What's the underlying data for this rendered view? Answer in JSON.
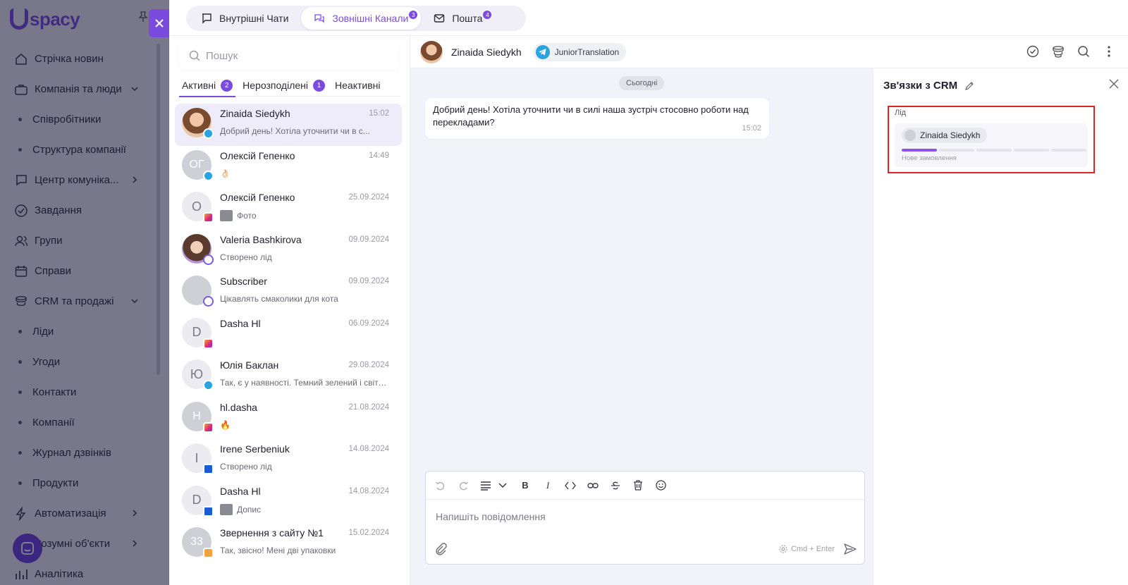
{
  "app": {
    "logo": "spacy",
    "nav": [
      {
        "label": "Стрічка новин",
        "icon": "home-icon"
      },
      {
        "label": "Компанія та люди",
        "icon": "briefcase-icon",
        "expandable": true
      },
      {
        "label": "Співробітники",
        "sub": true
      },
      {
        "label": "Структура компанії",
        "sub": true
      },
      {
        "label": "Центр комуніка...",
        "icon": "chat-icon",
        "expandable": true
      },
      {
        "label": "Завдання",
        "icon": "check-circle-icon"
      },
      {
        "label": "Групи",
        "icon": "users-icon"
      },
      {
        "label": "Справи",
        "icon": "calendar-icon"
      },
      {
        "label": "CRM та продажі",
        "icon": "funnel-icon",
        "expandable": true
      },
      {
        "label": "Ліди",
        "sub": true
      },
      {
        "label": "Угоди",
        "sub": true
      },
      {
        "label": "Контакти",
        "sub": true
      },
      {
        "label": "Компанії",
        "sub": true
      },
      {
        "label": "Журнал дзвінків",
        "sub": true
      },
      {
        "label": "Продукти",
        "sub": true
      },
      {
        "label": "Автоматизація",
        "icon": "bolt-icon",
        "expandable": true
      },
      {
        "label": "Розумні об'єкти",
        "icon": "cube-icon",
        "expandable": true
      },
      {
        "label": "Аналітика",
        "icon": "chart-icon"
      }
    ]
  },
  "tabs": [
    {
      "label": "Внутрішні Чати",
      "icon": "chat-bubble-icon",
      "badge": ""
    },
    {
      "label": "Зовнішні Канали",
      "icon": "channels-icon",
      "badge": "3",
      "active": true
    },
    {
      "label": "Пошта",
      "icon": "mail-icon",
      "badge": "4"
    }
  ],
  "chat_list": {
    "search_placeholder": "Пошук",
    "subtabs": [
      {
        "label": "Активні",
        "count": "2",
        "active": true
      },
      {
        "label": "Нерозподілені",
        "count": "1"
      },
      {
        "label": "Неактивні",
        "count": ""
      }
    ],
    "items": [
      {
        "name": "Zinaida Siedykh",
        "time": "15:02",
        "message": "Добрий день! Хотіла уточнити чи в с...",
        "initials": "",
        "avatar": "photo1",
        "channel": "telegram",
        "selected": true
      },
      {
        "name": "Олексій Гепенко",
        "time": "14:49",
        "message": "👌🏻",
        "initials": "ОГ",
        "avatar": "gray",
        "channel": "telegram"
      },
      {
        "name": "Олексій Гепенко",
        "time": "25.09.2024",
        "message": "Фото",
        "initials": "О",
        "avatar": "light",
        "channel": "instagram",
        "thumb": true
      },
      {
        "name": "Valeria Bashkirova",
        "time": "09.09.2024",
        "message": "Створено лід",
        "initials": "",
        "avatar": "photo2",
        "channel": "viber"
      },
      {
        "name": "Subscriber",
        "time": "09.09.2024",
        "message": "Цікавлять смаколики для кота",
        "initials": "",
        "avatar": "gray",
        "channel": "viber"
      },
      {
        "name": "Dasha Hl",
        "time": "06.09.2024",
        "message": "",
        "initials": "D",
        "avatar": "light",
        "channel": "instagram"
      },
      {
        "name": "Юлія Баклан",
        "time": "29.08.2024",
        "message": "Так, є у наявності. Темний зелений і світл...",
        "initials": "Ю",
        "avatar": "light",
        "channel": "telegram"
      },
      {
        "name": "hl.dasha",
        "time": "21.08.2024",
        "message": "🔥",
        "initials": "H",
        "avatar": "gray",
        "channel": "instagram"
      },
      {
        "name": "Irene Serbeniuk",
        "time": "14.08.2024",
        "message": "Створено лід",
        "initials": "I",
        "avatar": "light",
        "channel": "facebook"
      },
      {
        "name": "Dasha Hl",
        "time": "14.08.2024",
        "message": "Допис",
        "initials": "D",
        "avatar": "light",
        "channel": "facebook",
        "thumb": true
      },
      {
        "name": "Звернення з сайту №1",
        "time": "15.02.2024",
        "message": "Так, звісно! Мені дві упаковки",
        "initials": "33",
        "avatar": "gray",
        "channel": "site"
      }
    ]
  },
  "chat": {
    "contact_name": "Zinaida Siedykh",
    "channel_chip": "JuniorTranslation",
    "date_label": "Сьогодні",
    "message": {
      "text": "Добрий день! Хотіла уточнити чи в силі наша зустріч стосовно роботи над перекладами?",
      "time": "15:02"
    },
    "composer": {
      "placeholder": "Напишіть повідомлення",
      "hint": "Cmd + Enter"
    }
  },
  "crm": {
    "title": "Зв'язки з CRM",
    "entity_label": "Лід",
    "contact": "Zinaida Siedykh",
    "stage": "Нове замовлення",
    "stage_progress": {
      "current": 1,
      "total": 5
    }
  },
  "colors": {
    "accent": "#7b4be0",
    "telegram": "#2aa3e1",
    "highlight_box": "#e02424"
  }
}
